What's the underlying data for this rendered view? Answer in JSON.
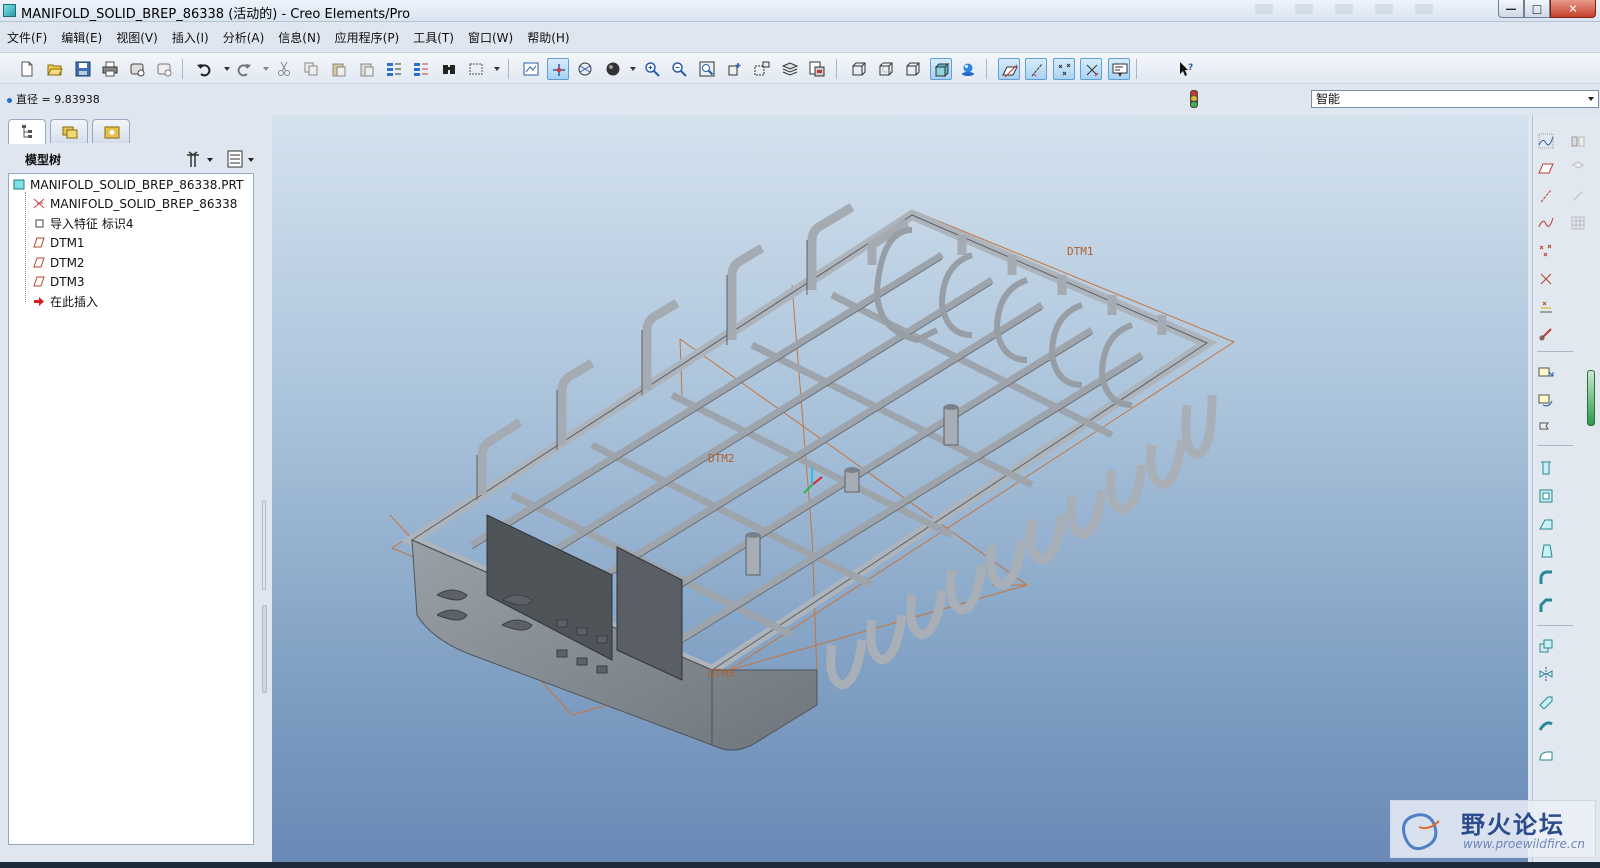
{
  "window": {
    "title": "MANIFOLD_SOLID_BREP_86338 (活动的) - Creo Elements/Pro",
    "controls": [
      "minimize",
      "maximize",
      "close"
    ]
  },
  "menubar": {
    "items": [
      {
        "label": "文件(F)"
      },
      {
        "label": "编辑(E)"
      },
      {
        "label": "视图(V)"
      },
      {
        "label": "插入(I)"
      },
      {
        "label": "分析(A)"
      },
      {
        "label": "信息(N)"
      },
      {
        "label": "应用程序(P)"
      },
      {
        "label": "工具(T)"
      },
      {
        "label": "窗口(W)"
      },
      {
        "label": "帮助(H)"
      }
    ]
  },
  "toolbar": {
    "icons": [
      "new-icon",
      "open-icon",
      "save-icon",
      "print-icon",
      "send-mail-icon",
      "send-icon",
      "undo-icon",
      "redo-icon",
      "cut-icon",
      "copy-icon",
      "paste-icon",
      "paste-special-icon",
      "regenerate-icon",
      "regen-manager-icon",
      "find-icon",
      "select-box-icon",
      "repaint-icon",
      "spin-center-icon",
      "orient-mode-icon",
      "shading-icon",
      "zoom-in-icon",
      "zoom-out-icon",
      "refit-icon",
      "reorient-icon",
      "saved-views-icon",
      "layers-icon",
      "view-manager-icon",
      "wireframe-icon",
      "hidden-line-icon",
      "no-hidden-icon",
      "shaded-icon",
      "enhanced-realism-icon",
      "datum-planes-icon",
      "datum-axes-icon",
      "datum-points-icon",
      "coordinate-systems-icon",
      "annotations-icon",
      "whats-this-icon"
    ]
  },
  "info": {
    "message": "直径 = 9.83938",
    "filter_value": "智能"
  },
  "model_tree": {
    "heading": "模型树",
    "items": [
      {
        "label": "MANIFOLD_SOLID_BREP_86338.PRT",
        "icon": "part-icon"
      },
      {
        "label": "MANIFOLD_SOLID_BREP_86338",
        "icon": "csys-icon"
      },
      {
        "label": "导入特征 标识4",
        "icon": "import-feature-icon"
      },
      {
        "label": "DTM1",
        "icon": "datum-plane-icon"
      },
      {
        "label": "DTM2",
        "icon": "datum-plane-icon"
      },
      {
        "label": "DTM3",
        "icon": "datum-plane-icon"
      },
      {
        "label": "在此插入",
        "icon": "insert-here-icon"
      }
    ]
  },
  "viewport": {
    "datum_labels": {
      "dtm1": "DTM1",
      "dtm2": "DTM2",
      "dtm3": "DTM3"
    },
    "colors": {
      "model": "#a7adb4",
      "model_dark": "#5c6168",
      "datum": "#c8743a",
      "bg_top": "#d4e2ee",
      "bg_bottom": "#6a88b5"
    }
  },
  "watermark": {
    "title": "野火论坛",
    "url": "www.proewildfire.cn"
  }
}
